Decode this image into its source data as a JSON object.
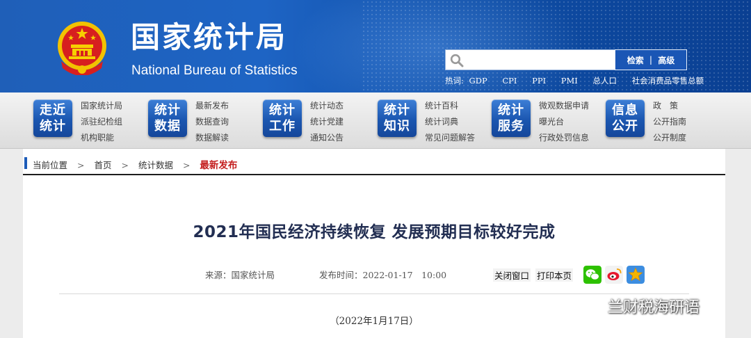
{
  "header": {
    "logo_cn": "国家统计局",
    "logo_en": "National Bureau of Statistics",
    "search": {
      "placeholder": "",
      "search_label": "检索",
      "advanced_label": "高级"
    },
    "hotwords_label": "热词:",
    "hotwords": [
      "GDP",
      "CPI",
      "PPI",
      "PMI",
      "总人口",
      "社会消费品零售总额"
    ]
  },
  "nav": [
    {
      "tile": [
        "走近",
        "统计"
      ],
      "links": [
        "国家统计局",
        "派驻纪检组",
        "机构职能"
      ]
    },
    {
      "tile": [
        "统计",
        "数据"
      ],
      "links": [
        "最新发布",
        "数据查询",
        "数据解读"
      ]
    },
    {
      "tile": [
        "统计",
        "工作"
      ],
      "links": [
        "统计动态",
        "统计党建",
        "通知公告"
      ]
    },
    {
      "tile": [
        "统计",
        "知识"
      ],
      "links": [
        "统计百科",
        "统计词典",
        "常见问题解答"
      ]
    },
    {
      "tile": [
        "统计",
        "服务"
      ],
      "links": [
        "微观数据申请",
        "曝光台",
        "行政处罚信息"
      ]
    },
    {
      "tile": [
        "信息",
        "公开"
      ],
      "links": [
        "政　策",
        "公开指南",
        "公开制度"
      ]
    }
  ],
  "breadcrumb": {
    "label": "当前位置",
    "sep": ">",
    "items": [
      "首页",
      "统计数据"
    ],
    "current": "最新发布"
  },
  "article": {
    "title": "2021年国民经济持续恢复 发展预期目标较好完成",
    "source": "来源：国家统计局",
    "published": "发布时间：2022-01-17　10:00",
    "close_label": "关闭窗口",
    "print_label": "打印本页",
    "date_line": "（2022年1月17日）"
  },
  "watermark": "兰财税海研语",
  "colors": {
    "header_blue": "#1e64c4",
    "title_navy": "#222e52",
    "current_red": "#c41e1e",
    "wechat": "#2dc100",
    "weibo": "#e6162d",
    "favorite": "#f5b400"
  }
}
